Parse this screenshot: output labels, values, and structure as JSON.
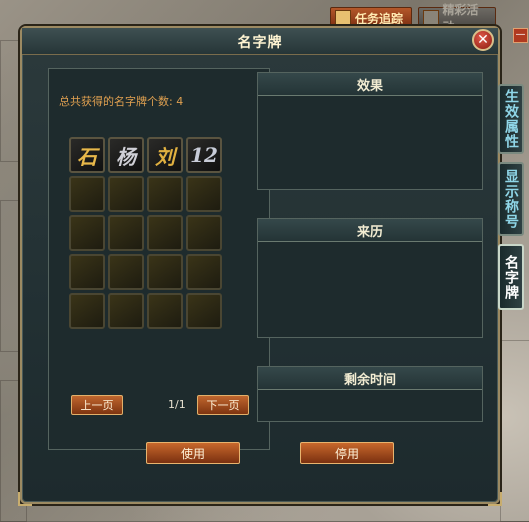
{
  "top_bar": {
    "task_tracking_label": "任务追踪",
    "second_label": "精彩活动"
  },
  "window": {
    "title": "名字牌",
    "close_glyph": "✕"
  },
  "left_panel": {
    "count_text": "总共获得的名字牌个数: 4",
    "items": [
      {
        "glyph": "石",
        "color": "#e8b84a"
      },
      {
        "glyph": "杨",
        "color": "#cfcfd6"
      },
      {
        "glyph": "刘",
        "color": "#e0b040"
      },
      {
        "glyph": "12",
        "color": "#c8ccd8"
      }
    ],
    "empty_slots": 16,
    "pager": {
      "prev_label": "上一页",
      "page_info": "1/1",
      "next_label": "下一页"
    }
  },
  "right_panel": {
    "effect_title": "效果",
    "origin_title": "来历",
    "remaining_title": "剩余时间"
  },
  "buttons": {
    "use_label": "使用",
    "stop_label": "停用"
  },
  "side_tabs": [
    {
      "label": "生效属性",
      "color": "#8fd6e8"
    },
    {
      "label": "显示称号",
      "color": "#8fd6e8"
    },
    {
      "label": "名字牌",
      "color": "#ffffff"
    }
  ],
  "mini_button": "—"
}
